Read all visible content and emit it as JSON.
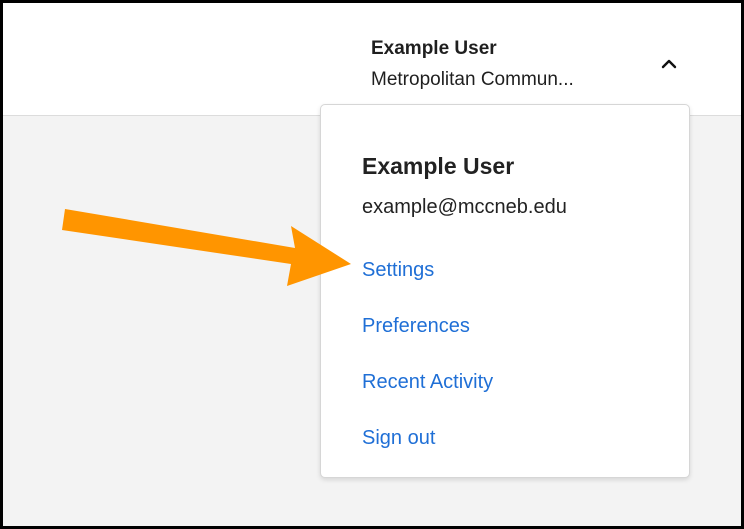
{
  "header": {
    "user_name": "Example User",
    "organization": "Metropolitan Commun...",
    "toggle_icon": "chevron-up-icon"
  },
  "account_menu": {
    "name": "Example User",
    "email": "example@mccneb.edu",
    "items": [
      {
        "label": "Settings"
      },
      {
        "label": "Preferences"
      },
      {
        "label": "Recent Activity"
      },
      {
        "label": "Sign out"
      }
    ]
  },
  "annotation": {
    "icon": "pointer-arrow-icon",
    "color": "#ff9500"
  },
  "colors": {
    "link": "#1f6fd6",
    "background": "#f3f3f3"
  }
}
